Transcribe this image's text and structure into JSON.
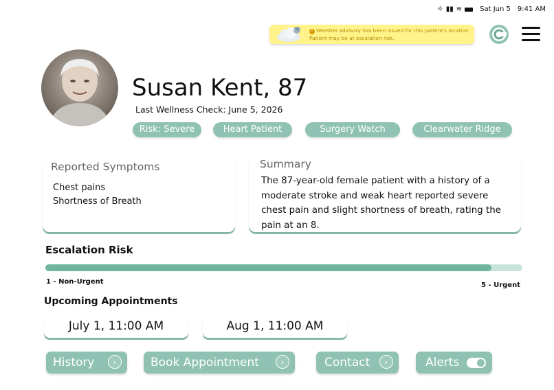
{
  "status_bar": {
    "date": "Sat Jun 5",
    "time": "9:41 AM"
  },
  "advisory": {
    "text": "Weather advisory has been issued for this patient's location. Patient may be at escalation risk."
  },
  "patient": {
    "name_age": "Susan Kent, 87",
    "wellness_check": "Last Wellness Check: June 5, 2026",
    "tags": [
      "Risk: Severe",
      "Heart Patient",
      "Surgery Watch",
      "Clearwater Ridge"
    ]
  },
  "symptoms": {
    "title": "Reported Symptoms",
    "items": [
      "Chest pains",
      "Shortness of Breath"
    ]
  },
  "summary": {
    "title": "Summary",
    "text": "The 87-year-old female patient with a history of a moderate stroke and weak heart reported severe chest pain and slight shortness of breath, rating the pain at an 8."
  },
  "escalation": {
    "title": "Escalation Risk",
    "min_label": "1 - Non-Urgent",
    "max_label": "5 - Urgent",
    "level_fraction": 0.935
  },
  "appointments": {
    "title": "Upcoming Appointments",
    "items": [
      "July 1, 11:00 AM",
      "Aug 1, 11:00 AM"
    ]
  },
  "actions": {
    "history": "History",
    "book": "Book Appointment",
    "contact": "Contact",
    "alerts": "Alerts"
  },
  "colors": {
    "accent": "#8fc2b2",
    "accent_dark": "#6fb59f",
    "advisory_bg": "#fff38a"
  }
}
